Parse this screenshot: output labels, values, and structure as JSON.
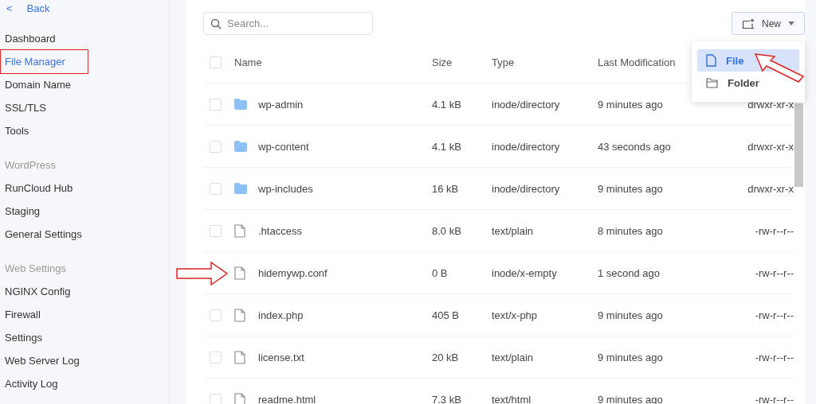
{
  "sidebar": {
    "back": {
      "icon": "<",
      "label": "Back"
    },
    "groups": [
      {
        "items": [
          {
            "label": "Dashboard",
            "selected": false,
            "highlighted": false
          },
          {
            "label": "File Manager",
            "selected": true,
            "highlighted": true
          },
          {
            "label": "Domain Name",
            "selected": false,
            "highlighted": false
          },
          {
            "label": "SSL/TLS",
            "selected": false,
            "highlighted": false
          },
          {
            "label": "Tools",
            "selected": false,
            "highlighted": false
          }
        ]
      },
      {
        "heading": "WordPress",
        "items": [
          {
            "label": "RunCloud Hub",
            "selected": false,
            "highlighted": false
          },
          {
            "label": "Staging",
            "selected": false,
            "highlighted": false
          },
          {
            "label": "General Settings",
            "selected": false,
            "highlighted": false
          }
        ]
      },
      {
        "heading": "Web Settings",
        "items": [
          {
            "label": "NGINX Config",
            "selected": false,
            "highlighted": false
          },
          {
            "label": "Firewall",
            "selected": false,
            "highlighted": false
          },
          {
            "label": "Settings",
            "selected": false,
            "highlighted": false
          },
          {
            "label": "Web Server Log",
            "selected": false,
            "highlighted": false
          },
          {
            "label": "Activity Log",
            "selected": false,
            "highlighted": false
          }
        ]
      }
    ]
  },
  "search": {
    "placeholder": "Search..."
  },
  "new_button": {
    "label": "New"
  },
  "new_menu": [
    {
      "kind": "file",
      "label": "File",
      "selected": true,
      "arrow_marked": true
    },
    {
      "kind": "folder",
      "label": "Folder",
      "selected": false,
      "arrow_marked": false
    }
  ],
  "table": {
    "select_all_checked": false,
    "columns": [
      "Name",
      "Size",
      "Type",
      "Last Modification"
    ],
    "rows": [
      {
        "kind": "folder",
        "name": "wp-admin",
        "size": "4.1 kB",
        "type": "inode/directory",
        "modified": "9 minutes ago",
        "permissions": "drwxr-xr-x",
        "checked": false,
        "arrow_marked": false
      },
      {
        "kind": "folder",
        "name": "wp-content",
        "size": "4.1 kB",
        "type": "inode/directory",
        "modified": "43 seconds ago",
        "permissions": "drwxr-xr-x",
        "checked": false,
        "arrow_marked": false
      },
      {
        "kind": "folder",
        "name": "wp-includes",
        "size": "16 kB",
        "type": "inode/directory",
        "modified": "9 minutes ago",
        "permissions": "drwxr-xr-x",
        "checked": false,
        "arrow_marked": false
      },
      {
        "kind": "file",
        "name": ".htaccess",
        "size": "8.0 kB",
        "type": "text/plain",
        "modified": "8 minutes ago",
        "permissions": "-rw-r--r--",
        "checked": false,
        "arrow_marked": false
      },
      {
        "kind": "file",
        "name": "hidemywp.conf",
        "size": "0 B",
        "type": "inode/x-empty",
        "modified": "1 second ago",
        "permissions": "-rw-r--r--",
        "arrow_marked": true
      },
      {
        "kind": "file",
        "name": "index.php",
        "size": "405 B",
        "type": "text/x-php",
        "modified": "9 minutes ago",
        "permissions": "-rw-r--r--",
        "checked": false,
        "arrow_marked": false
      },
      {
        "kind": "file",
        "name": "license.txt",
        "size": "20 kB",
        "type": "text/plain",
        "modified": "9 minutes ago",
        "permissions": "-rw-r--r--",
        "checked": false,
        "arrow_marked": false
      },
      {
        "kind": "file",
        "name": "readme.html",
        "size": "7.3 kB",
        "type": "text/html",
        "modified": "9 minutes ago",
        "permissions": "-rw-r--r--",
        "checked": false,
        "arrow_marked": false
      }
    ]
  }
}
